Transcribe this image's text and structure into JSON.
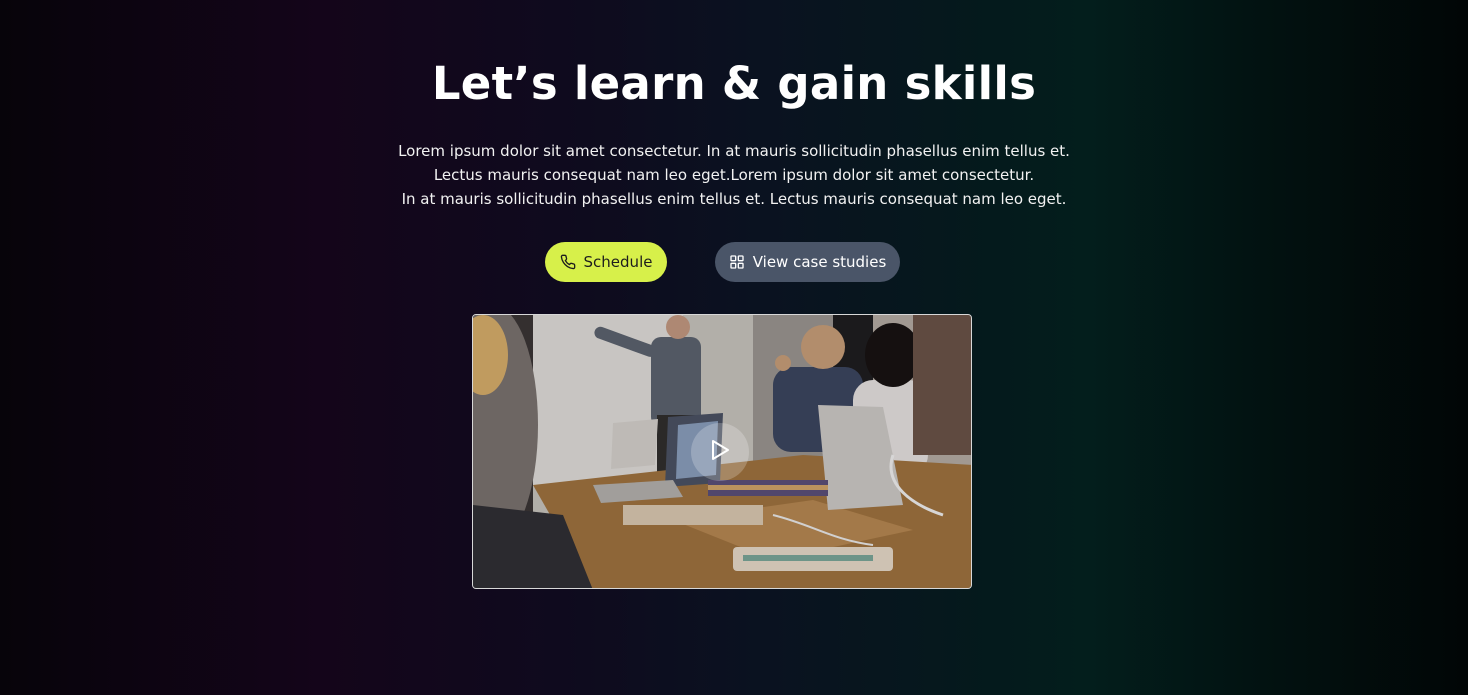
{
  "hero": {
    "title": "Let’s learn & gain skills",
    "description_lines": [
      "Lorem ipsum dolor sit amet consectetur. In at mauris sollicitudin phasellus enim tellus et.",
      "Lectus mauris consequat nam leo eget.Lorem ipsum dolor sit amet consectetur.",
      "In at mauris sollicitudin phasellus enim tellus et. Lectus mauris consequat nam leo eget."
    ]
  },
  "buttons": {
    "schedule": {
      "label": "Schedule",
      "icon": "phone-icon",
      "color": "#d7f04a"
    },
    "case_studies": {
      "label": "View case studies",
      "icon": "grid-icon",
      "color": "#4a5568"
    }
  },
  "video": {
    "icon": "play-icon"
  }
}
